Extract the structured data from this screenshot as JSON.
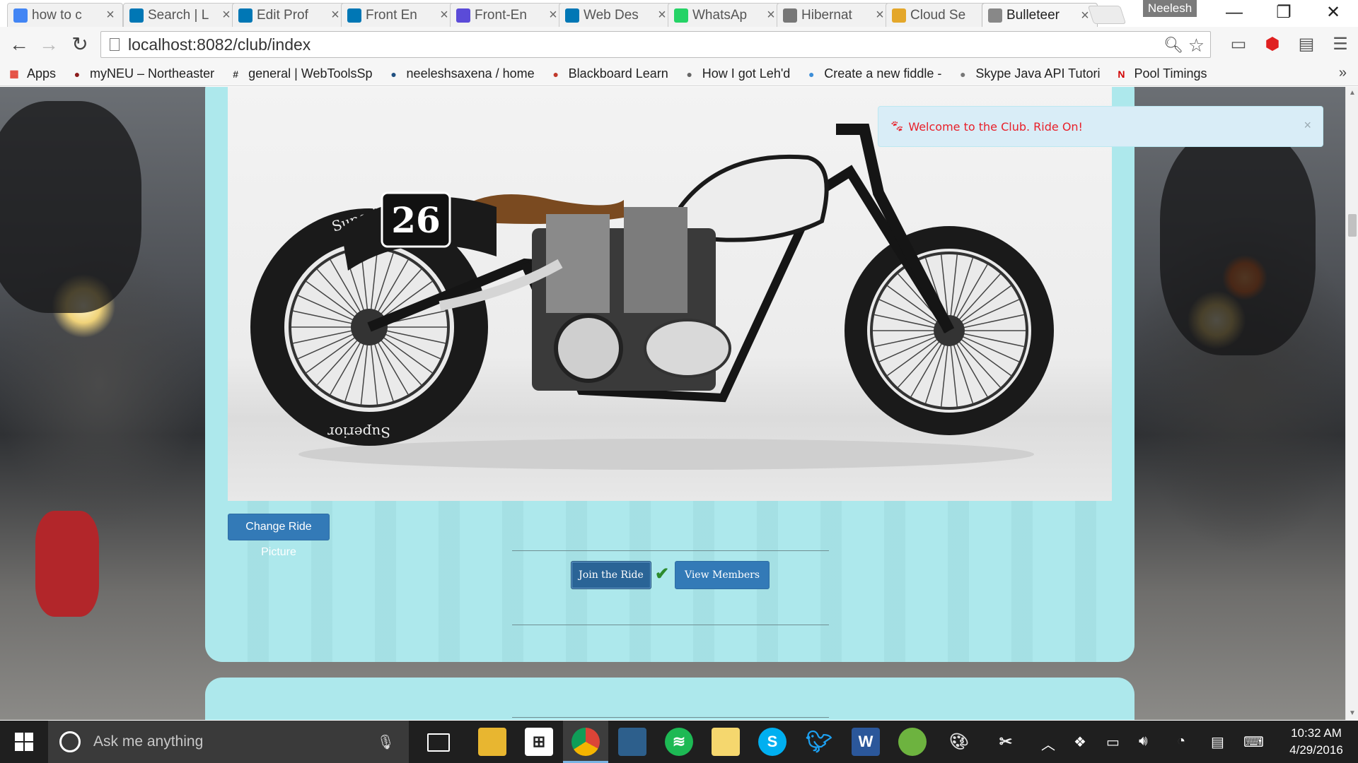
{
  "browser": {
    "tabs": [
      {
        "title": "how to c",
        "icon": "google-icon",
        "color": "#4285f4"
      },
      {
        "title": "Search | L",
        "icon": "linkedin-icon",
        "color": "#0077b5"
      },
      {
        "title": "Edit Prof",
        "icon": "linkedin-icon",
        "color": "#0077b5"
      },
      {
        "title": "Front En",
        "icon": "linkedin-icon",
        "color": "#0077b5"
      },
      {
        "title": "Front-En",
        "icon": "pluralsight-icon",
        "color": "#5b4bd8"
      },
      {
        "title": "Web Des",
        "icon": "linkedin-icon",
        "color": "#0077b5"
      },
      {
        "title": "WhatsAp",
        "icon": "whatsapp-icon",
        "color": "#25d366"
      },
      {
        "title": "Hibernat",
        "icon": "jboss-icon",
        "color": "#777777"
      },
      {
        "title": "Cloud Se",
        "icon": "package-icon",
        "color": "#e4a72a"
      },
      {
        "title": "Bulleteer",
        "icon": "page-icon",
        "color": "#888888"
      }
    ],
    "user": "Neelesh",
    "url": "localhost:8082/club/index",
    "bookmarks": [
      {
        "label": "Apps",
        "icon": "apps-grid-icon"
      },
      {
        "label": "myNEU – Northeaster",
        "icon": "paw-icon"
      },
      {
        "label": "general | WebToolsSp",
        "icon": "slack-hash-icon"
      },
      {
        "label": "neeleshsaxena / home",
        "icon": "bitbucket-icon"
      },
      {
        "label": "Blackboard Learn",
        "icon": "blackboard-icon"
      },
      {
        "label": "How I got Leh'd",
        "icon": "folder-icon"
      },
      {
        "label": "Create a new fiddle -",
        "icon": "jsfiddle-icon"
      },
      {
        "label": "Skype Java API Tutori",
        "icon": "page-icon"
      },
      {
        "label": "Pool Timings",
        "icon": "netflix-n-icon"
      }
    ]
  },
  "page": {
    "alert": "Welcome to the Club. Ride On!",
    "alert_close": "×",
    "change_picture": "Change Ride Picture",
    "join": "Join the Ride",
    "view_members": "View Members",
    "photo_number": "26",
    "tire_brand": "Superior"
  },
  "taskbar": {
    "search_placeholder": "Ask me anything",
    "time": "10:32 AM",
    "date": "4/29/2016"
  }
}
